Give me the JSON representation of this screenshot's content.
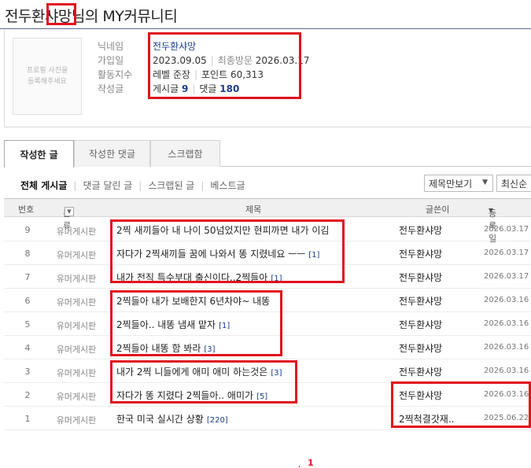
{
  "page": {
    "title": "전두환샤망님의 MY커뮤니티"
  },
  "profile": {
    "photo_text": "프로필 사진을\n등록해주세요",
    "labels": {
      "nickname": "닉네임",
      "joined": "가입일",
      "activity": "활동지수",
      "written": "작성글"
    },
    "nickname": "전두환샤망",
    "joined_date": "2023.09.05",
    "last_visit_label": "최종방문",
    "last_visit_date": "2026.03.17",
    "level": "레벨 준장",
    "points": "포인트 60,313",
    "posts_label": "게시글",
    "posts_count": "9",
    "comments_label": "댓글",
    "comments_count": "180"
  },
  "tabs": [
    {
      "label": "작성한 글",
      "active": true
    },
    {
      "label": "작성한 댓글",
      "active": false
    },
    {
      "label": "스크랩함",
      "active": false
    }
  ],
  "subnav": [
    {
      "label": "전체 게시글",
      "active": true
    },
    {
      "label": "댓글 달린 글",
      "active": false
    },
    {
      "label": "스크랩된 글",
      "active": false
    },
    {
      "label": "베스트글",
      "active": false
    }
  ],
  "view_select": {
    "value": "제목만보기"
  },
  "sort_select": {
    "value": "최신순"
  },
  "table": {
    "headers": {
      "no": "번호",
      "category": "분류",
      "title": "제목",
      "author": "글쓴이",
      "date": "등록일"
    },
    "rows": [
      {
        "no": "9",
        "category": "유머게시판",
        "title": "2찍 새끼들아 내 나이 50넘었지만 현피까면 내가 이김",
        "comments": "",
        "author": "전두환샤망",
        "date": "2026.03.17"
      },
      {
        "no": "8",
        "category": "유머게시판",
        "title": "자다가 2찍새끼들 꿈에 나와서 똥 지렸네요 ㅡㅡ",
        "comments": "[1]",
        "author": "전두환샤망",
        "date": "2026.03.17"
      },
      {
        "no": "7",
        "category": "유머게시판",
        "title": "내가 전직 특수부대 출신이다..2찍들아",
        "comments": "[1]",
        "author": "전두환샤망",
        "date": "2026.03.17"
      },
      {
        "no": "6",
        "category": "유머게시판",
        "title": "2찍들아 내가 보배한지 6년차야~ 내똥",
        "comments": "",
        "author": "전두환샤망",
        "date": "2026.03.16"
      },
      {
        "no": "5",
        "category": "유머게시판",
        "title": "2찍들아.. 내똥 냄새 맡자",
        "comments": "[1]",
        "author": "전두환샤망",
        "date": "2026.03.16"
      },
      {
        "no": "4",
        "category": "유머게시판",
        "title": "2찍들아 내똥 함 봐라",
        "comments": "[3]",
        "author": "전두환샤망",
        "date": "2026.03.16"
      },
      {
        "no": "3",
        "category": "유머게시판",
        "title": "내가 2찍 니들에게 애미 애미 하는것은",
        "comments": "[3]",
        "author": "전두환샤망",
        "date": "2026.03.16"
      },
      {
        "no": "2",
        "category": "유머게시판",
        "title": "자다가 똥 지렸다 2찍들아.. 애미가",
        "comments": "[5]",
        "author": "전두환샤망",
        "date": "2026.03.16"
      },
      {
        "no": "1",
        "category": "유머게시판",
        "title": "한국 미국 실시간 상황",
        "comments": "[220]",
        "author": "2찍척결갓재..",
        "date": "2025.06.22"
      }
    ]
  },
  "pagination": {
    "current": "1"
  },
  "colors": {
    "highlight": "#e0131e",
    "link": "#1a3d8f"
  }
}
